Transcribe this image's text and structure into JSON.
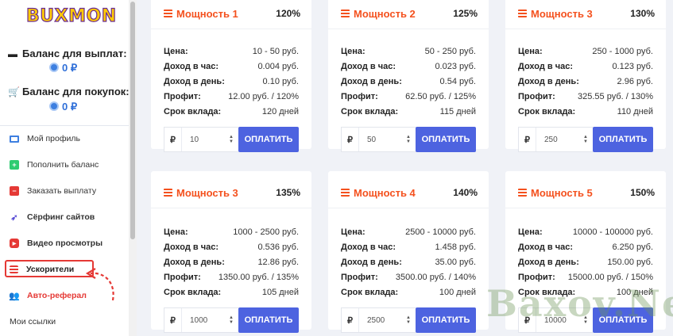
{
  "sidebar": {
    "logo": "BUXMON",
    "balance_payout_label": "Баланс для выплат:",
    "balance_payout_value": "0 ₽",
    "balance_purchase_label": "Баланс для покупок:",
    "balance_purchase_value": "0 ₽",
    "nav": [
      {
        "label": "Мой профиль",
        "icon": "monitor-icon",
        "color": "#3d7fe0"
      },
      {
        "label": "Пополнить баланс",
        "icon": "plus-square-icon",
        "color": "#2ecc71"
      },
      {
        "label": "Заказать выплату",
        "icon": "minus-square-icon",
        "color": "#e53935"
      },
      {
        "label": "Сёрфинг сайтов",
        "icon": "rocket-icon",
        "color": "#5b4fd6"
      },
      {
        "label": "Видео просмотры",
        "icon": "youtube-icon",
        "color": "#e53935"
      },
      {
        "label": "Ускорители",
        "icon": "server-icon",
        "color": "#e53935"
      },
      {
        "label": "Авто-реферал",
        "icon": "users-icon",
        "color": "#e53935"
      },
      {
        "label": "Мои ссылки",
        "icon": "",
        "color": "#333333"
      }
    ]
  },
  "labels": {
    "price": "Цена:",
    "per_hour": "Доход в час:",
    "per_day": "Доход в день:",
    "profit": "Профит:",
    "term": "Срок вклада:",
    "currency": "₽",
    "pay_button": "ОПЛАТИТЬ"
  },
  "cards": [
    {
      "title": "Мощность 1",
      "percent": "120%",
      "price": "10 - 50 руб.",
      "per_hour": "0.004 руб.",
      "per_day": "0.10 руб.",
      "profit": "12.00 руб. / 120%",
      "term": "120 дней",
      "amount": "10"
    },
    {
      "title": "Мощность 2",
      "percent": "125%",
      "price": "50 - 250 руб.",
      "per_hour": "0.023 руб.",
      "per_day": "0.54 руб.",
      "profit": "62.50 руб. / 125%",
      "term": "115 дней",
      "amount": "50"
    },
    {
      "title": "Мощность 3",
      "percent": "130%",
      "price": "250 - 1000 руб.",
      "per_hour": "0.123 руб.",
      "per_day": "2.96 руб.",
      "profit": "325.55 руб. / 130%",
      "term": "110 дней",
      "amount": "250"
    },
    {
      "title": "Мощность 3",
      "percent": "135%",
      "price": "1000 - 2500 руб.",
      "per_hour": "0.536 руб.",
      "per_day": "12.86 руб.",
      "profit": "1350.00 руб. / 135%",
      "term": "105 дней",
      "amount": "1000"
    },
    {
      "title": "Мощность 4",
      "percent": "140%",
      "price": "2500 - 10000 руб.",
      "per_hour": "1.458 руб.",
      "per_day": "35.00 руб.",
      "profit": "3500.00 руб. / 140%",
      "term": "100 дней",
      "amount": "2500"
    },
    {
      "title": "Мощность 5",
      "percent": "150%",
      "price": "10000 - 100000 руб.",
      "per_hour": "6.250 руб.",
      "per_day": "150.00 руб.",
      "profit": "15000.00 руб. / 150%",
      "term": "100 дней",
      "amount": "10000"
    }
  ],
  "watermark": "Baxov.Net",
  "colors": {
    "accent": "#4d63e0",
    "title": "#f4511e",
    "balance": "#2f6fd8",
    "highlight": "#e53935"
  }
}
